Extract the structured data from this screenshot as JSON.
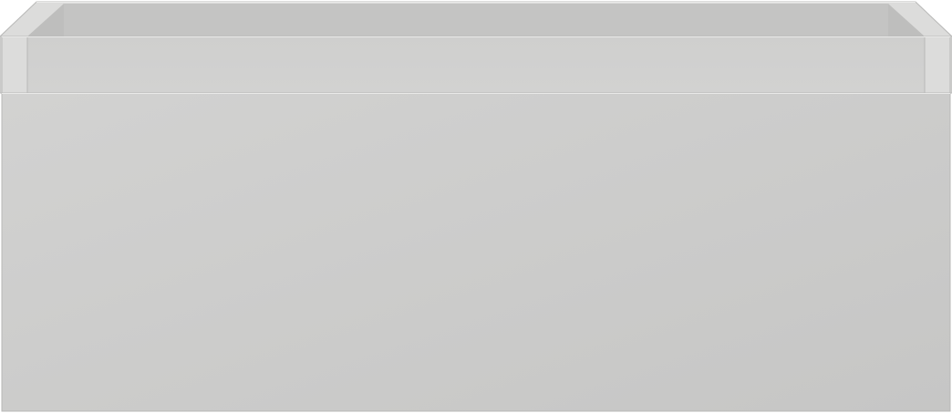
{
  "object": {
    "name": "drawer unit",
    "colors": {
      "front_light": "#d2d2d1",
      "front_dark": "#c6c6c5",
      "top_edge": "#dcdcdb",
      "inner_back": "#c4c4c3",
      "inner_side": "#bebebd",
      "rail": "#cfcfce",
      "edge_highlight": "#e9e9e8",
      "outline": "#b8b8b7",
      "background": "#ffffff"
    }
  }
}
